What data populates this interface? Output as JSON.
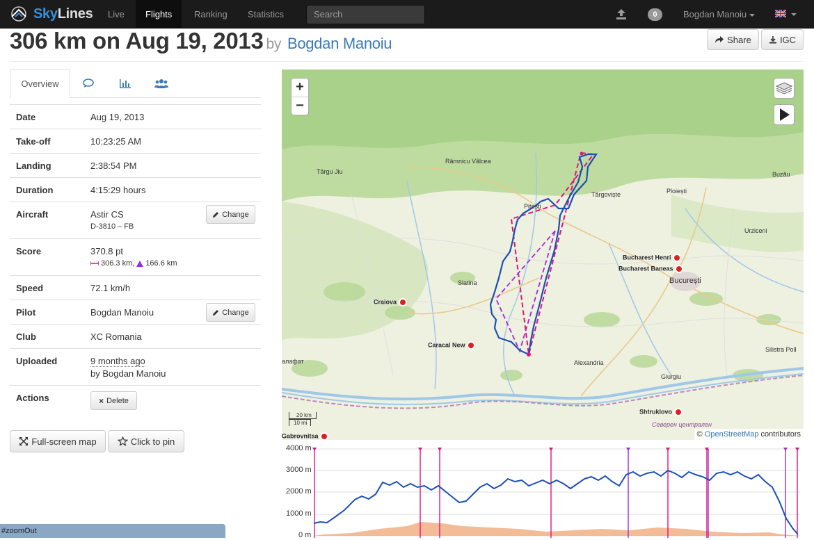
{
  "nav": {
    "brand": "SkyLines",
    "brand_prefix": "Sky",
    "brand_suffix": "Lines",
    "links": [
      "Live",
      "Flights",
      "Ranking",
      "Statistics"
    ],
    "active": "Flights",
    "search_placeholder": "Search",
    "notifications": "0",
    "user": "Bogdan Manoiu",
    "icons": [
      "skylines-logo-icon",
      "upload-icon",
      "uk-flag-icon"
    ]
  },
  "title": {
    "main": "306 km on Aug 19, 2013",
    "by": "by",
    "author": "Bogdan Manoiu",
    "share": "Share",
    "igc": "IGC"
  },
  "tabs": {
    "overview": "Overview",
    "icons": [
      "comments-icon",
      "chart-icon",
      "users-icon"
    ]
  },
  "info": {
    "date_label": "Date",
    "date": "Aug 19, 2013",
    "takeoff_label": "Take-off",
    "takeoff": "10:23:25 AM",
    "landing_label": "Landing",
    "landing": "2:38:54 PM",
    "duration_label": "Duration",
    "duration": "4:15:29 hours",
    "aircraft_label": "Aircraft",
    "aircraft": "Astir CS",
    "registration": "D-3810 – FB",
    "score_label": "Score",
    "score": "370.8 pt",
    "distance_free": "306.3 km,",
    "distance_triangle": "166.6 km",
    "speed_label": "Speed",
    "speed": "72.1 km/h",
    "pilot_label": "Pilot",
    "pilot": "Bogdan Manoiu",
    "club_label": "Club",
    "club": "XC Romania",
    "uploaded_label": "Uploaded",
    "uploaded": "9 months ago",
    "uploaded_by": "by Bogdan Manoiu",
    "actions_label": "Actions",
    "delete": "Delete",
    "change": "Change"
  },
  "buttons": {
    "fullscreen": "Full-screen map",
    "pin": "Click to pin"
  },
  "status": "#zoomOut",
  "map": {
    "zoom_in": "+",
    "zoom_out": "−",
    "attribution_prefix": "© ",
    "attribution_link": "OpenStreetMap",
    "attribution_suffix": " contributors",
    "scale_km": "20 km",
    "scale_mi": "10 mi",
    "cities": [
      {
        "name": "Târgu Jiu"
      },
      {
        "name": "Râmnicu Vâlcea"
      },
      {
        "name": "Buzău"
      },
      {
        "name": "Ploiești"
      },
      {
        "name": "Târgoviște"
      },
      {
        "name": "Pitești"
      },
      {
        "name": "Urziceni"
      },
      {
        "name": "Slatina"
      },
      {
        "name": "București"
      },
      {
        "name": "Alexandria"
      },
      {
        "name": "Giurgiu"
      },
      {
        "name": "Silistra Poll"
      },
      {
        "name": "Северен централен"
      },
      {
        "name": "алафат"
      }
    ],
    "airports": [
      {
        "name": "Bucharest Henri"
      },
      {
        "name": "Bucharest Baneas"
      },
      {
        "name": "Craiova"
      },
      {
        "name": "Caracal New"
      },
      {
        "name": "Shtruklovo"
      },
      {
        "name": "Gabrovnitsa"
      }
    ]
  },
  "barogram": {
    "y_ticks": [
      "4000 m",
      "3000 m",
      "2000 m",
      "1000 m",
      "0 m"
    ]
  }
}
